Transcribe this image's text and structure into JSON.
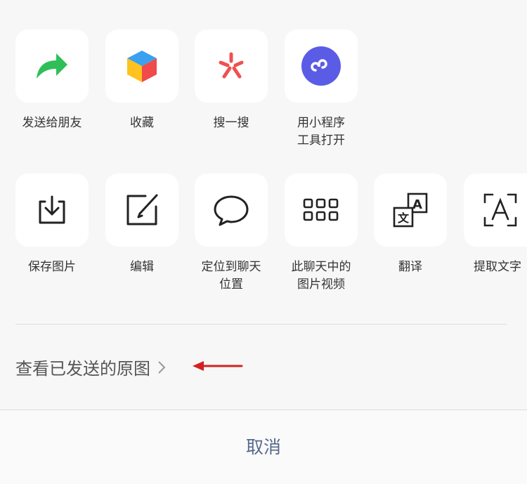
{
  "row1": [
    {
      "label": "发送给朋友",
      "icon": "forward-arrow-icon"
    },
    {
      "label": "收藏",
      "icon": "favorite-cube-icon"
    },
    {
      "label": "搜一搜",
      "icon": "search-spark-icon"
    },
    {
      "label": "用小程序\n工具打开",
      "icon": "mini-program-icon"
    }
  ],
  "row2": [
    {
      "label": "保存图片",
      "icon": "save-download-icon"
    },
    {
      "label": "编辑",
      "icon": "edit-pencil-icon"
    },
    {
      "label": "定位到聊天\n位置",
      "icon": "chat-bubble-icon"
    },
    {
      "label": "此聊天中的\n图片视频",
      "icon": "grid-icon"
    },
    {
      "label": "翻译",
      "icon": "translate-icon"
    },
    {
      "label": "提取文字",
      "icon": "text-scan-icon"
    }
  ],
  "view_original": {
    "label": "查看已发送的原图"
  },
  "cancel": {
    "label": "取消"
  },
  "colors": {
    "background": "#f7f7f7",
    "tile": "#ffffff",
    "forward_green": "#2fbf59",
    "mini_program_purple": "#5b5ce6",
    "search_red": "#f05050",
    "cancel_text": "#56698c",
    "annotation_arrow": "#d42020"
  }
}
